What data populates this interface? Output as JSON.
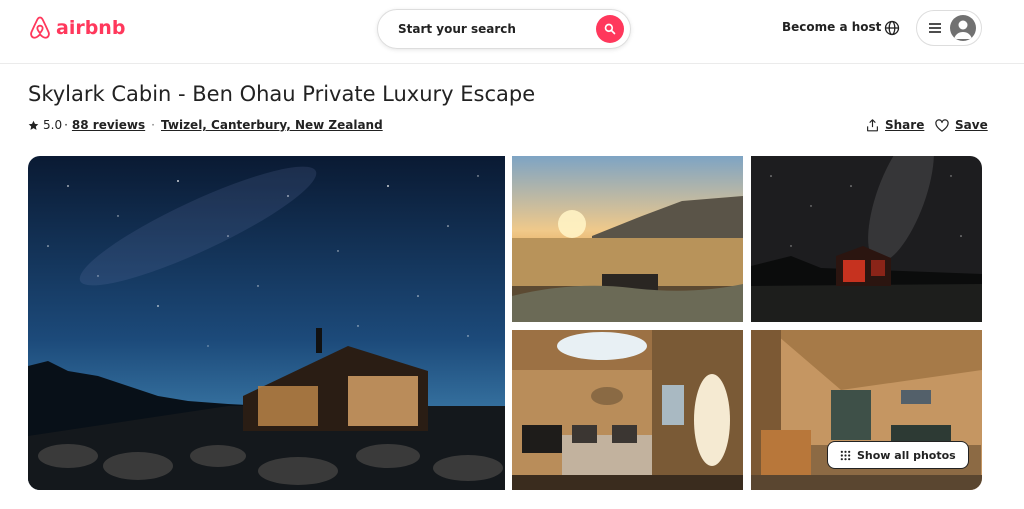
{
  "brand": {
    "name": "airbnb",
    "color": "#FF385C",
    "logo_icon": "airbnb-belo-icon"
  },
  "header": {
    "search_label": "Start your search",
    "search_icon": "search-icon",
    "host_link": "Become a host",
    "globe_icon": "globe-icon",
    "menu_icon": "hamburger-menu-icon",
    "avatar_icon": "user-avatar-icon"
  },
  "listing": {
    "title": "Skylark Cabin - Ben Ohau Private Luxury Escape",
    "rating": "5.0",
    "rating_separator": "·",
    "reviews": "88 reviews",
    "location": "Twizel, Canterbury, New Zealand",
    "share_label": "Share",
    "save_label": "Save"
  },
  "gallery": {
    "photos": [
      {
        "description": "cabin-under-starry-night-sky"
      },
      {
        "description": "sunset-over-grassland-with-cabin"
      },
      {
        "description": "lit-cabin-under-milky-way"
      },
      {
        "description": "bedroom-with-skylight"
      },
      {
        "description": "living-area-interior"
      }
    ],
    "show_all_label": "Show all photos",
    "grid_icon": "grid-dots-icon"
  }
}
